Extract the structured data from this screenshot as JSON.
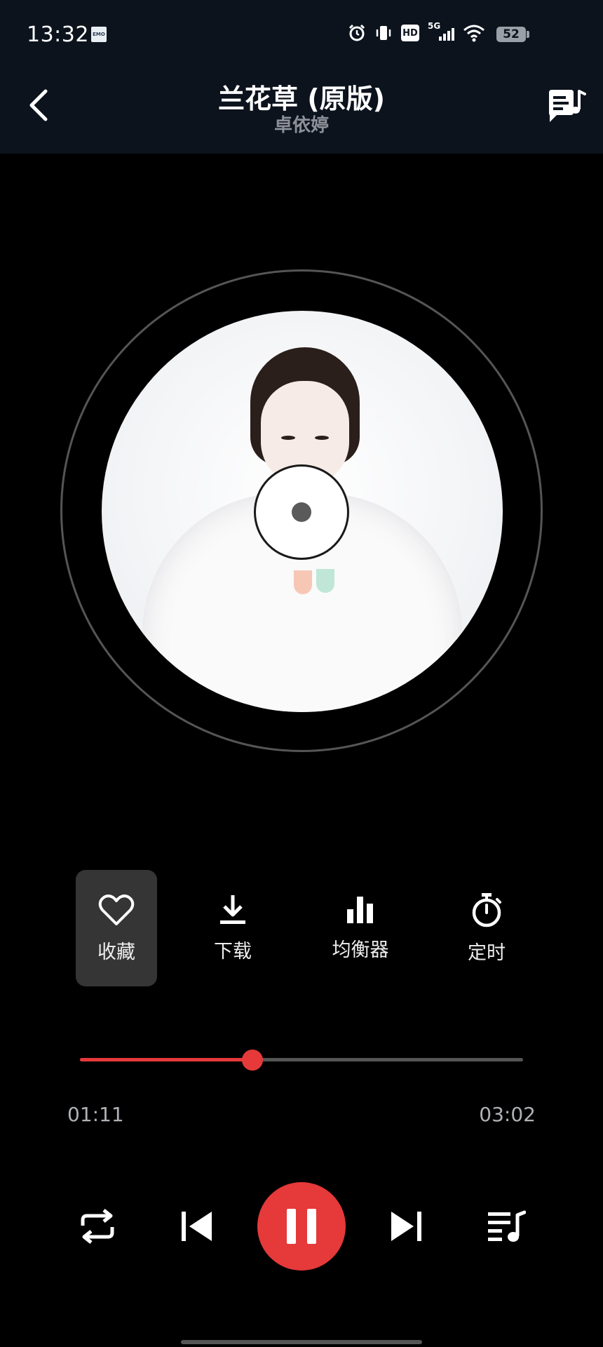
{
  "status_bar": {
    "time": "13:32",
    "app_icon_text": "EMO",
    "hd_label": "HD",
    "network_label": "5G",
    "battery_level": "52"
  },
  "header": {
    "title": "兰花草 (原版)",
    "artist": "卓依婷"
  },
  "actions": [
    {
      "label": "收藏",
      "icon": "heart-icon",
      "active": true
    },
    {
      "label": "下载",
      "icon": "download-icon",
      "active": false
    },
    {
      "label": "均衡器",
      "icon": "equalizer-icon",
      "active": false
    },
    {
      "label": "定时",
      "icon": "timer-icon",
      "active": false
    }
  ],
  "progress": {
    "current": "01:11",
    "total": "03:02",
    "fraction": 0.39
  },
  "controls": {
    "repeat_icon": "repeat-icon",
    "prev_icon": "previous-icon",
    "play_state": "playing",
    "next_icon": "next-icon",
    "playlist_icon": "playlist-icon"
  },
  "colors": {
    "accent": "#e5393a",
    "header_bg": "#0c131d",
    "background": "#000000"
  }
}
